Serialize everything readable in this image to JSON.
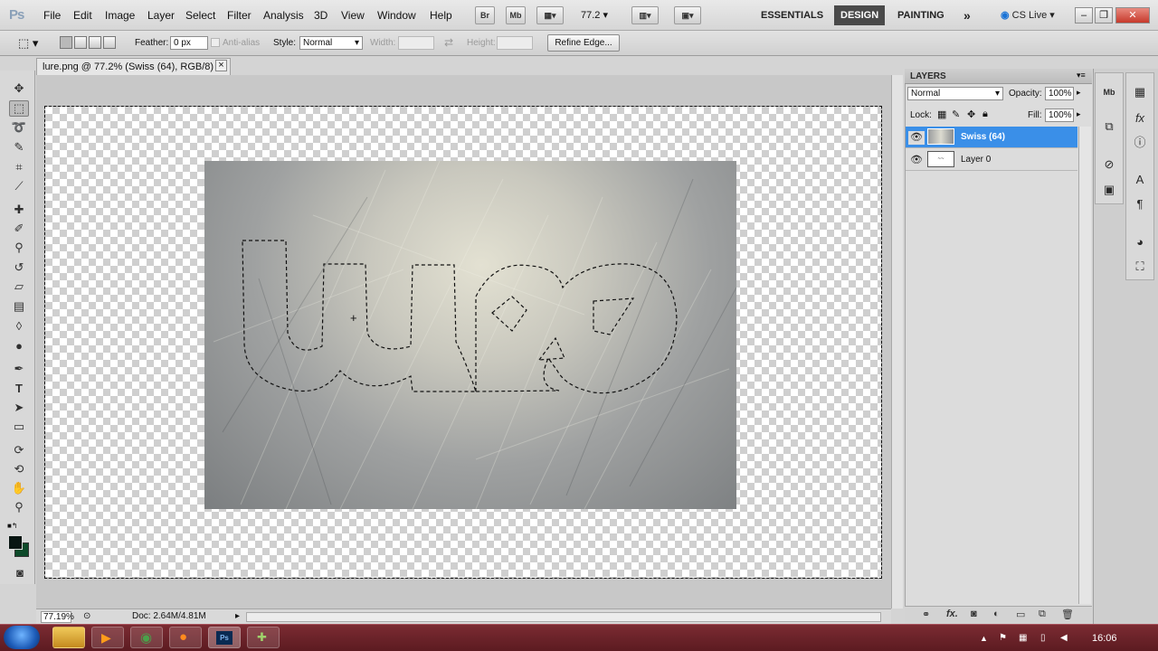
{
  "app": {
    "logo": "Ps"
  },
  "menu": [
    "File",
    "Edit",
    "Image",
    "Layer",
    "Select",
    "Filter",
    "Analysis",
    "3D",
    "View",
    "Window",
    "Help"
  ],
  "appbar": {
    "bridge": "Br",
    "minibridge": "Mb",
    "zoom": "77.2"
  },
  "workspaces": {
    "essentials": "ESSENTIALS",
    "design": "DESIGN",
    "painting": "PAINTING",
    "more": "»",
    "cslive": "CS Live"
  },
  "options": {
    "feather_label": "Feather:",
    "feather_value": "0 px",
    "antialias_label": "Anti-alias",
    "style_label": "Style:",
    "style_value": "Normal",
    "width_label": "Width:",
    "height_label": "Height:",
    "refine_edge": "Refine Edge..."
  },
  "document": {
    "tab_title": "lure.png @ 77.2% (Swiss (64), RGB/8) *",
    "close": "×"
  },
  "status": {
    "zoom": "77.19%",
    "doc": "Doc: 2.64M/4.81M"
  },
  "layers_panel": {
    "title": "LAYERS",
    "blend_mode": "Normal",
    "opacity_label": "Opacity:",
    "opacity_value": "100%",
    "lock_label": "Lock:",
    "fill_label": "Fill:",
    "fill_value": "100%",
    "layers": [
      {
        "name": "Swiss (64)",
        "selected": true
      },
      {
        "name": "Layer 0",
        "selected": false
      }
    ]
  },
  "taskbar": {
    "time": "16:06"
  },
  "colors": {
    "selection": "#3a8fe8",
    "taskbar": "#6a222a",
    "active_workspace": "#4a4a4a"
  }
}
